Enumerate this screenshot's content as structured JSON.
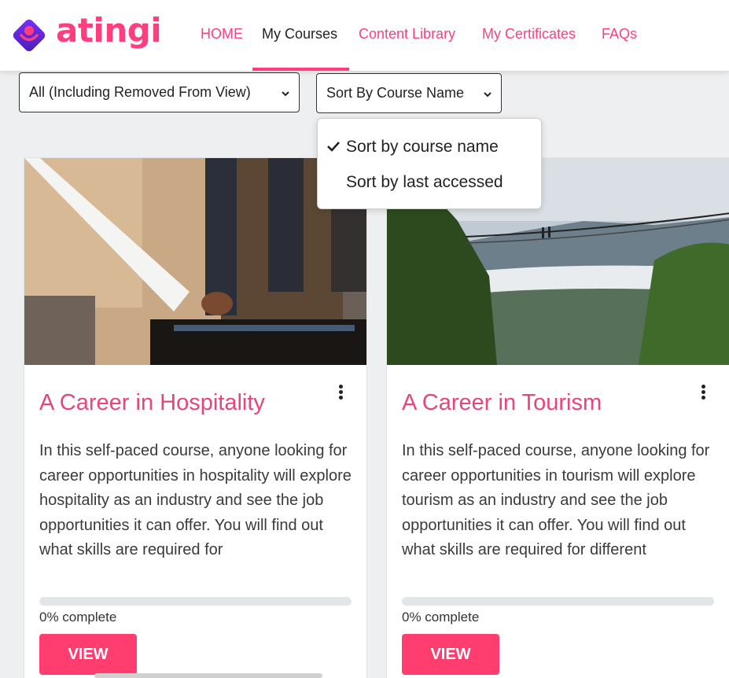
{
  "brand": {
    "name": "atingi",
    "color": "#ff3d7f"
  },
  "nav": {
    "items": [
      {
        "label": "HOME"
      },
      {
        "label": "My Courses"
      },
      {
        "label": "Content Library"
      },
      {
        "label": "My Certificates"
      },
      {
        "label": "FAQs"
      }
    ],
    "active": "My Courses"
  },
  "filters": {
    "view_filter": "All (Including Removed From View)",
    "sort": "Sort By Course Name"
  },
  "sort_menu": {
    "options": [
      {
        "label": "Sort by course name",
        "checked": true
      },
      {
        "label": "Sort by last accessed",
        "checked": false
      }
    ]
  },
  "courses": [
    {
      "title": "A Career in Hospitality",
      "description": "In this self-paced course, anyone looking for career opportunities in hospitality will explore hospitality as an industry and see the job opportunities it can offer. You will find out what skills are required for",
      "progress": 0,
      "progress_label": "0% complete",
      "button": "VIEW"
    },
    {
      "title": "A Career in Tourism",
      "description": "In this self-paced course, anyone looking for career opportunities in tourism will explore tourism as an industry and see the job opportunities it can offer. You will find out what skills are required for different",
      "progress": 0,
      "progress_label": "0% complete",
      "button": "VIEW"
    }
  ],
  "icons": [
    "atingi-logo-icon",
    "chevron-down-icon",
    "checkmark-icon",
    "more-vertical-icon"
  ],
  "colors": {
    "accent": "#ff3d7f",
    "title": "#e8457a",
    "button": "#ff3d6e"
  }
}
